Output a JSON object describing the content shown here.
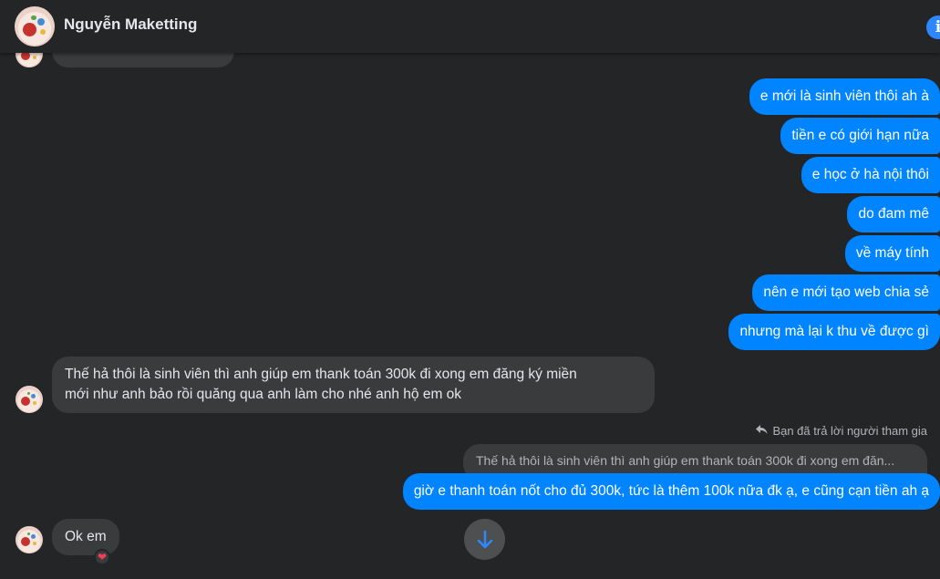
{
  "header": {
    "name": "Nguyễn Maketting",
    "info_icon": "info-icon",
    "info_glyph": "i"
  },
  "messages_out": [
    "e mới là sinh viên thôi ah à",
    "tiền e có giới hạn nữa",
    "e học ở hà nội thôi",
    "do đam mê",
    "về máy tính",
    "nên e mới tạo web chia sẻ",
    "nhưng mà lại k thu về được gì"
  ],
  "message_in_1": {
    "line1": "Thế hả thôi là sinh viên thì anh giúp em  thank toán 300k đi xong em đăng ký miền",
    "line2": "mới như anh bảo rồi quăng qua anh làm cho nhé anh hộ em ok"
  },
  "reply": {
    "label": "Bạn đã trả lời người tham gia",
    "quoted": "Thế hả thôi là sinh viên thì anh giúp em  thank toán 300k đi xong em đăn...",
    "message": "giờ e thanh toán nốt cho đủ 300k, tức là thêm 100k nữa đk ạ, e cũng cạn tiền ah ạ"
  },
  "message_in_2": {
    "text": "Ok em",
    "reaction": "❤"
  },
  "colors": {
    "background": "#242526",
    "outgoing_bubble": "#0084ff",
    "incoming_bubble": "#3a3b3c",
    "accent": "#2d88ff"
  },
  "icons": {
    "scroll_down": "arrow-down-icon",
    "reply": "reply-arrow-icon"
  }
}
